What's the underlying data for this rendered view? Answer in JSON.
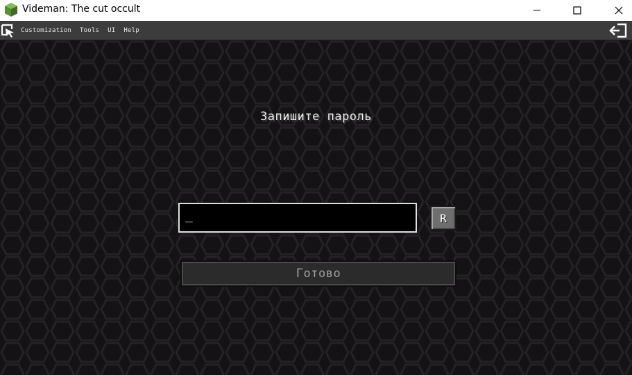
{
  "window": {
    "title": "Videman: The cut occult",
    "app_icon": "grass-block-icon",
    "controls": {
      "minimize": "—",
      "maximize": "☐",
      "close": "✕"
    }
  },
  "menubar": {
    "logo_icon": "ui-logo-icon",
    "items": [
      {
        "label": "Customization"
      },
      {
        "label": "Tools"
      },
      {
        "label": "UI"
      },
      {
        "label": "Help"
      }
    ],
    "exit_icon": "exit-icon"
  },
  "screen": {
    "prompt": "Запишите пароль",
    "password_field": {
      "value": "_"
    },
    "reveal_button_label": "R",
    "done_button_label": "Готово"
  },
  "colors": {
    "menubar_bg": "#3c3c3c",
    "game_bg": "#141214",
    "pattern": "#242224",
    "field_border": "#e0e0e0",
    "done_text": "#a0a0a0"
  }
}
